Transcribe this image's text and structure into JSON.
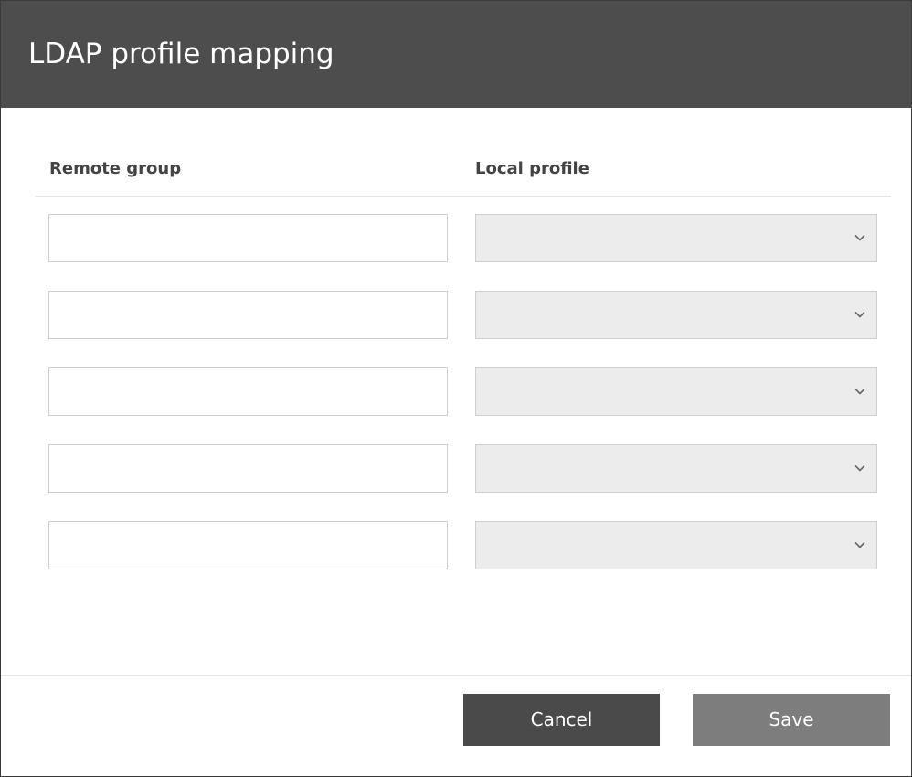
{
  "dialog": {
    "title": "LDAP profile mapping"
  },
  "table": {
    "headers": {
      "remote_group": "Remote group",
      "local_profile": "Local profile"
    },
    "rows": [
      {
        "remote_group": "",
        "local_profile": ""
      },
      {
        "remote_group": "",
        "local_profile": ""
      },
      {
        "remote_group": "",
        "local_profile": ""
      },
      {
        "remote_group": "",
        "local_profile": ""
      },
      {
        "remote_group": "",
        "local_profile": ""
      }
    ]
  },
  "icons": {
    "dropdown": "chevron-down-icon"
  },
  "footer": {
    "cancel_label": "Cancel",
    "save_label": "Save"
  },
  "colors": {
    "header_bg": "#4d4d4d",
    "cancel_bg": "#4a4a4a",
    "save_bg": "#7d7d7d",
    "select_bg": "#ececec"
  }
}
